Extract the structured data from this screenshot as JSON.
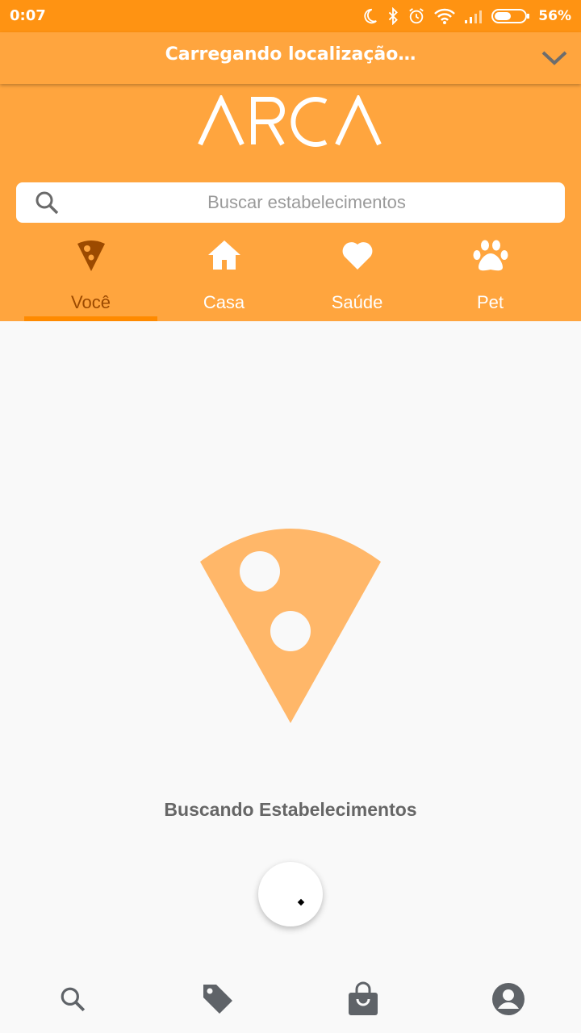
{
  "status_bar": {
    "time": "0:07",
    "battery_percent": "56%",
    "icons": [
      "moon-icon",
      "bluetooth-icon",
      "alarm-icon",
      "wifi-icon",
      "signal-icon",
      "battery-icon"
    ]
  },
  "location_bar": {
    "text": "Carregando localização…",
    "icon": "chevron-down-icon"
  },
  "header": {
    "logo_text": "ARCA",
    "search": {
      "placeholder": "Buscar estabelecimentos",
      "value": ""
    },
    "tabs": [
      {
        "label": "Você",
        "icon": "pizza-slice-icon",
        "active": true
      },
      {
        "label": "Casa",
        "icon": "home-icon",
        "active": false
      },
      {
        "label": "Saúde",
        "icon": "heart-icon",
        "active": false
      },
      {
        "label": "Pet",
        "icon": "paw-icon",
        "active": false
      }
    ]
  },
  "main": {
    "illustration": "pizza-slice-icon",
    "loading_text": "Buscando Estabelecimentos"
  },
  "bottom_nav": {
    "items": [
      "search-icon",
      "tag-icon",
      "shopping-bag-icon",
      "account-icon"
    ]
  },
  "colors": {
    "status_bar": "#ff9312",
    "header": "#ffa53e",
    "active_tab_text": "#9c4a00",
    "tab_indicator": "#ff8a00",
    "illustration": "#ffb769",
    "nav_icon": "#5f6368"
  }
}
